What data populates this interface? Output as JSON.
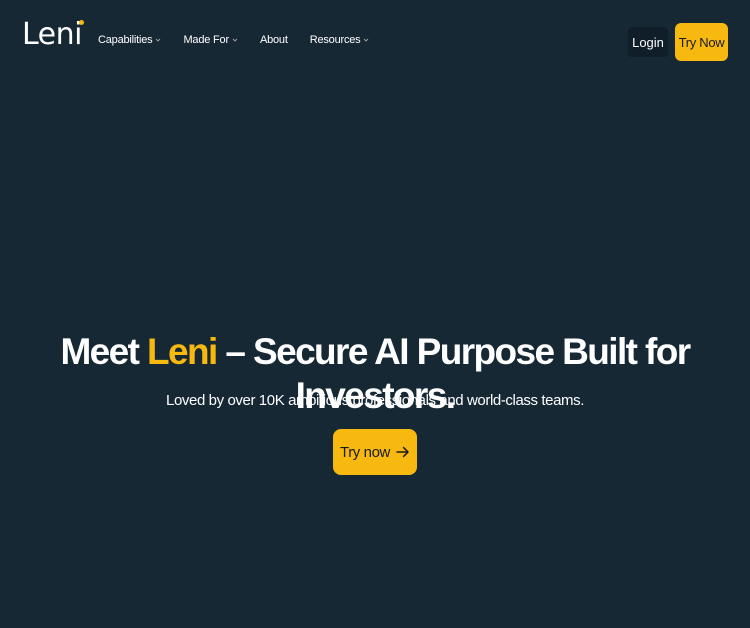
{
  "brand": {
    "logo_text_main": "Len",
    "logo_text_i": "i",
    "accent_color": "#f7b90f",
    "bg_color": "#172835"
  },
  "nav": {
    "items": [
      {
        "label": "Capabilities",
        "has_dropdown": true
      },
      {
        "label": "Made For",
        "has_dropdown": true
      },
      {
        "label": "About",
        "has_dropdown": false
      },
      {
        "label": "Resources",
        "has_dropdown": true
      }
    ],
    "login_label": "Login",
    "try_now_label": "Try Now"
  },
  "hero": {
    "title_pre": "Meet ",
    "title_accent": "Leni",
    "title_post": " – Secure AI Purpose Built for Investors.",
    "subtitle": "Loved by over 10K ambitious professionals and world-class teams.",
    "cta_label": "Try now",
    "cta_icon": "arrow-right-icon"
  }
}
